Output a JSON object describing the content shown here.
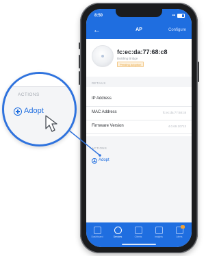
{
  "status_bar": {
    "time": "8:50"
  },
  "nav": {
    "back_icon": "back-arrow-icon",
    "title": "AP",
    "action": "Configure"
  },
  "device": {
    "mac": "fc:ec:da:77:68:c8",
    "subtitle": "Building Bridge",
    "badge": "Pending Adoption"
  },
  "details_section": {
    "label": "DETAILS",
    "rows": [
      {
        "label": "IP Address",
        "value": ""
      },
      {
        "label": "MAC Address",
        "value": "fc:ec:da:77:68:c8"
      },
      {
        "label": "Firmware Version",
        "value": "4.0.69.10713"
      }
    ]
  },
  "actions_section": {
    "label": "ACTIONS",
    "adopt": "Adopt"
  },
  "tabbar": {
    "tabs": [
      {
        "label": "Dashboard",
        "icon": "dashboard-icon",
        "active": false
      },
      {
        "label": "Devices",
        "icon": "devices-icon",
        "active": true
      },
      {
        "label": "Clients",
        "icon": "clients-icon",
        "active": false
      },
      {
        "label": "Insights",
        "icon": "insights-icon",
        "active": false
      },
      {
        "label": "Alerts",
        "icon": "alerts-icon",
        "active": false
      }
    ]
  },
  "magnifier": {
    "label": "ACTIONS",
    "adopt": "Adopt"
  },
  "colors": {
    "accent": "#1f6ee0",
    "callout": "#2f73de",
    "badge": "#f0a236"
  }
}
